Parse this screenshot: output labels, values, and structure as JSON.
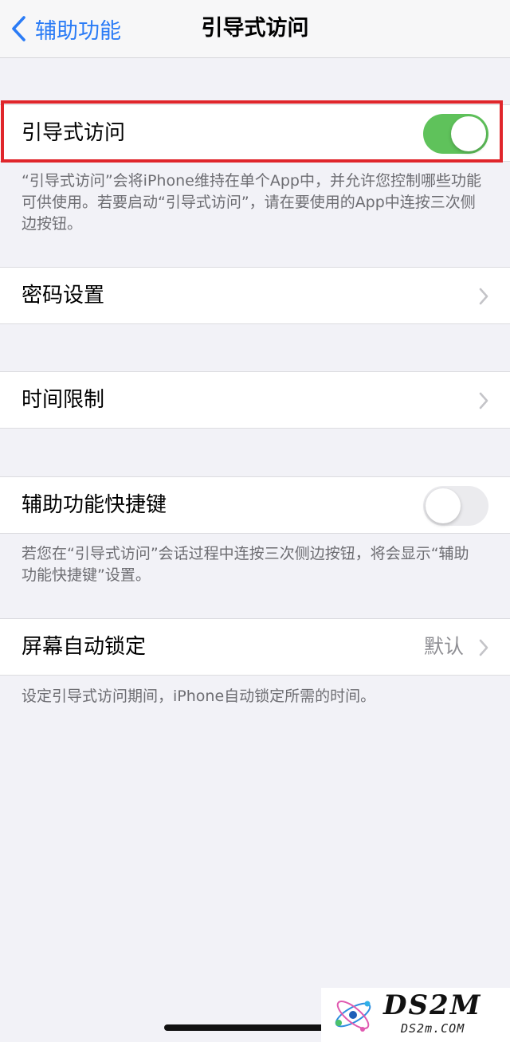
{
  "nav": {
    "back_label": "辅助功能",
    "title": "引导式访问"
  },
  "guided_access": {
    "label": "引导式访问",
    "toggle_on": true,
    "toggle_color": "#5fc25b",
    "footer": "“引导式访问”会将iPhone维持在单个App中，并允许您控制哪些功能可供使用。若要启动“引导式访问”，请在要使用的App中连按三次侧边按钮。"
  },
  "passcode": {
    "label": "密码设置"
  },
  "time_limits": {
    "label": "时间限制"
  },
  "accessibility_shortcut": {
    "label": "辅助功能快捷键",
    "toggle_on": false,
    "footer": "若您在“引导式访问”会话过程中连按三次侧边按钮，将会显示“辅助功能快捷键”设置。"
  },
  "auto_lock": {
    "label": "屏幕自动锁定",
    "value": "默认",
    "footer": "设定引导式访问期间，iPhone自动锁定所需的时间。"
  },
  "colors": {
    "accent": "#2b7cf6",
    "highlight_border": "#e0262b",
    "background": "#f2f2f7"
  },
  "watermark": {
    "brand": "DS2M",
    "domain": "DS2m.COM"
  }
}
